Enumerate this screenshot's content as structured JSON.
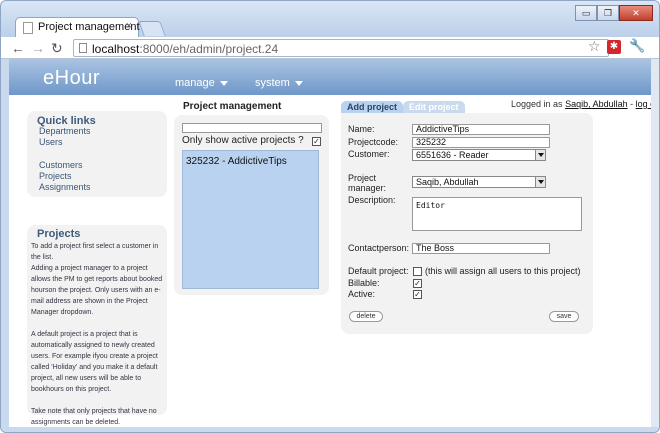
{
  "browser": {
    "tab_title": "Project management",
    "tab_close": "×",
    "url_host": "localhost",
    "url_path": ":8000/eh/admin/project.24",
    "back": "←",
    "forward": "→",
    "reload": "↻",
    "star": "☆",
    "ext": "✱",
    "wrench": "🔧",
    "minimize": "▭",
    "maximize": "❐",
    "close": "✕"
  },
  "header": {
    "logo": "eHour",
    "menu": [
      {
        "label": "manage"
      },
      {
        "label": "system"
      }
    ]
  },
  "user": {
    "prefix": "Logged in as",
    "name": "Saqib, Abdullah",
    "separator": "-",
    "logout": "log off"
  },
  "quick_links": {
    "title": "Quick links",
    "items": [
      "Departments",
      "Users",
      "Customers",
      "Projects",
      "Assignments"
    ]
  },
  "projects_info": {
    "title": "Projects",
    "text": "To add a project first select a customer in the list.\nAdding a project manager to a project allows the PM to get reports about booked hourson the project. Only users with an e-mail address are shown in the Project Manager dropdown.\n\nA default project is a project that is automatically assigned to newly created users. For example ifyou create a project called 'Holiday' and you make it a default project, all new users will be able to bookhours on this project.\n\nTake note that only projects that have no assignments can be deleted."
  },
  "project_list": {
    "title": "Project management",
    "filter_value": "",
    "active_label": "Only show active projects ?",
    "active_checked": "✓",
    "items": [
      "325232 - AddictiveTips"
    ]
  },
  "form": {
    "tab_add": "Add project",
    "tab_edit": "Edit project",
    "fields": {
      "name_label": "Name:",
      "name_value": "AddictiveTips",
      "code_label": "Projectcode:",
      "code_value": "325232",
      "customer_label": "Customer:",
      "customer_value": "6551636 - Reader",
      "manager_label_1": "Project",
      "manager_label_2": "manager:",
      "manager_value": "Saqib, Abdullah",
      "description_label": "Description:",
      "description_value": "Editor",
      "contact_label": "Contactperson:",
      "contact_value": "The Boss",
      "default_label": "Default project:",
      "default_note": "(this will assign all users to this project)",
      "billable_label": "Billable:",
      "billable_checked": "✓",
      "active_label": "Active:",
      "active_checked": "✓"
    },
    "delete_label": "delete",
    "save_label": "save"
  }
}
